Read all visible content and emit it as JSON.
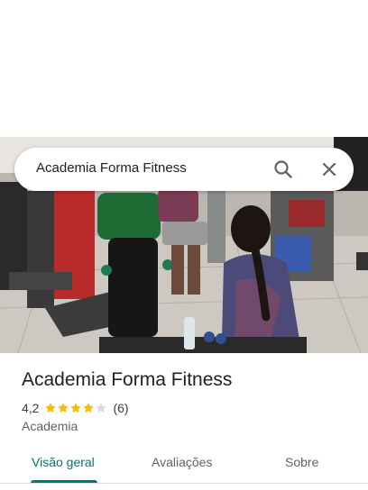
{
  "search": {
    "query": "Academia Forma Fitness"
  },
  "place": {
    "name": "Academia Forma Fitness",
    "rating": "4,2",
    "rating_stars": 4.2,
    "review_count": "(6)",
    "category": "Academia"
  },
  "tabs": [
    {
      "label": "Visão geral",
      "active": true
    },
    {
      "label": "Avaliações",
      "active": false
    },
    {
      "label": "Sobre",
      "active": false
    }
  ],
  "colors": {
    "accent": "#00796b",
    "star": "#fbbc04",
    "star_empty": "#dadce0"
  },
  "icons": {
    "search": "search-icon",
    "close": "close-icon"
  }
}
